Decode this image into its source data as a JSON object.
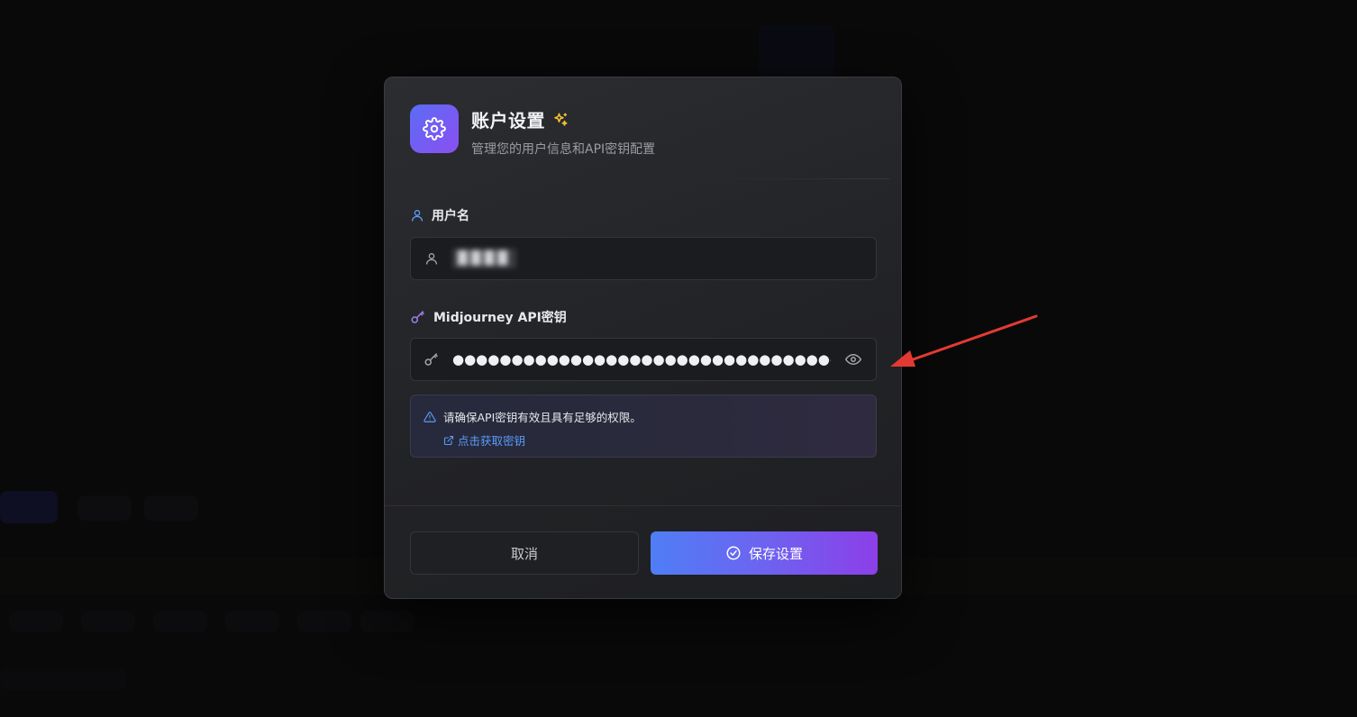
{
  "colors": {
    "accent_start": "#4f7ef6",
    "accent_end": "#8c3fe8",
    "link": "#5b9bf8",
    "annotation_arrow": "#e23a32"
  },
  "dialog": {
    "title": "账户设置",
    "subtitle": "管理您的用户信息和API密钥配置",
    "header_icon": "gear-icon",
    "title_decoration_icon": "sparkles-icon"
  },
  "fields": {
    "username": {
      "label": "用户名",
      "label_icon": "user-icon",
      "input_icon": "user-icon",
      "value": "████"
    },
    "api_key": {
      "label": "Midjourney API密钥",
      "label_icon": "key-icon",
      "input_icon": "key-icon",
      "value": "●●●●●●●●●●●●●●●●●●●●●●●●●●●●●●●●●●●●●●●●●●●",
      "toggle_icon": "eye-icon"
    }
  },
  "notice": {
    "icon": "warning-triangle-icon",
    "text": "请确保API密钥有效且具有足够的权限。",
    "link_icon": "external-link-icon",
    "link_text": "点击获取密钥"
  },
  "buttons": {
    "cancel": "取消",
    "save": "保存设置",
    "save_icon": "check-circle-icon"
  }
}
